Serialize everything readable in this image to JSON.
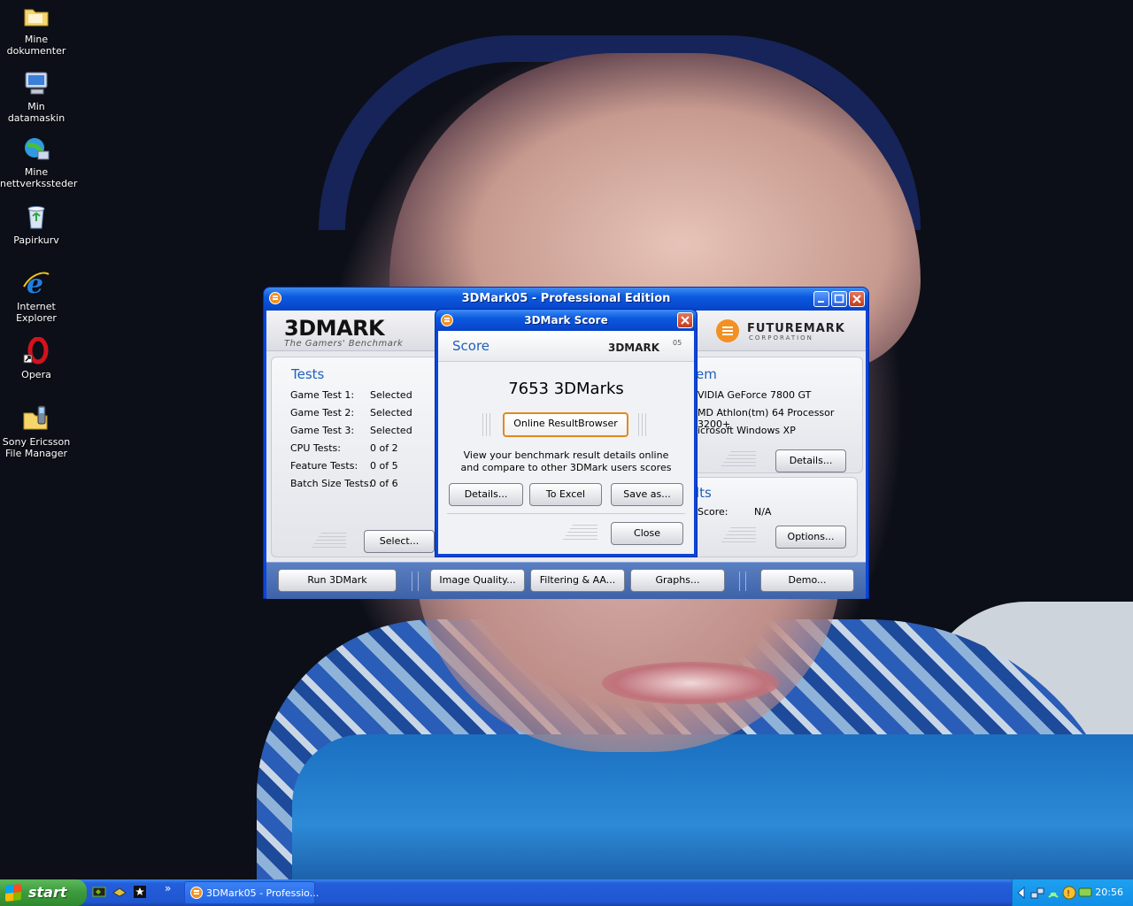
{
  "desktop": {
    "icons": [
      {
        "label": "Mine\ndokumenter",
        "icon": "folder-icon"
      },
      {
        "label": "Min datamaskin",
        "icon": "computer-icon"
      },
      {
        "label": "Mine\nnettverkssteder",
        "icon": "network-icon"
      },
      {
        "label": "Papirkurv",
        "icon": "recycle-bin-icon"
      },
      {
        "label": "Internet\nExplorer",
        "icon": "ie-icon"
      },
      {
        "label": "Opera",
        "icon": "opera-icon"
      },
      {
        "label": "Sony Ericsson\nFile Manager",
        "icon": "phone-folder-icon"
      }
    ]
  },
  "main_window": {
    "title": "3DMark05 - Professional Edition",
    "logo_text": "3DMARK",
    "logo_tagline": "The Gamers' Benchmark",
    "futuremark_text": "FUTUREMARK",
    "futuremark_sub": "CORPORATION",
    "tests": {
      "title": "Tests",
      "rows": [
        {
          "label": "Game Test 1:",
          "value": "Selected"
        },
        {
          "label": "Game Test 2:",
          "value": "Selected"
        },
        {
          "label": "Game Test 3:",
          "value": "Selected"
        },
        {
          "label": "CPU Tests:",
          "value": "0 of 2"
        },
        {
          "label": "Feature Tests:",
          "value": "0 of 5"
        },
        {
          "label": "Batch Size Tests:",
          "value": "0 of 6"
        }
      ],
      "select_button": "Select..."
    },
    "system": {
      "title_partial": "em",
      "rows": [
        "VIDIA GeForce 7800 GT",
        "MD Athlon(tm) 64 Processor 3200+",
        "icrosoft Windows XP"
      ],
      "details_button": "Details..."
    },
    "results": {
      "title_partial": "lts",
      "score_label": "Score:",
      "score_value": "N/A",
      "options_button": "Options..."
    },
    "bottom_buttons": {
      "run": "Run 3DMark",
      "image_quality": "Image Quality...",
      "filtering": "Filtering & AA...",
      "graphs": "Graphs...",
      "demo": "Demo..."
    }
  },
  "score_dialog": {
    "title": "3DMark Score",
    "header_label": "Score",
    "header_logo": "3DMARK",
    "header_logo_suffix": "05",
    "score": "7653 3DMarks",
    "online_button": "Online ResultBrowser",
    "description_line1": "View your benchmark result details online",
    "description_line2": "and compare to other 3DMark users scores",
    "details_button": "Details...",
    "excel_button": "To Excel",
    "save_button": "Save as...",
    "close_button": "Close"
  },
  "taskbar": {
    "start_label": "start",
    "task_label": "3DMark05 - Professio...",
    "chevron": "»",
    "clock": "20:56"
  },
  "colors": {
    "xp_blue": "#0a46d8",
    "section_title": "#1f5fbf",
    "futuremark_orange": "#f39022",
    "start_green": "#3c9a3c"
  }
}
